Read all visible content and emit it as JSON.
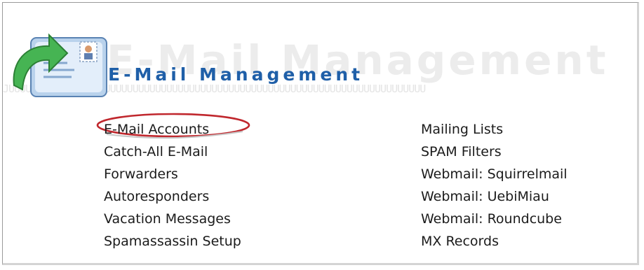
{
  "header": {
    "title": "E-Mail Management",
    "watermark": "E-Mail Management",
    "rail_pattern": "JUUUUUUUUUUUUUUUUUUUUUUUUUUUUUUUUUUUUUUUUUUUUUUUUUUUUUUUUUUUUUUUUUUUUUUUUUU"
  },
  "links": {
    "left": [
      "E-Mail Accounts",
      "Catch-All E-Mail",
      "Forwarders",
      "Autoresponders",
      "Vacation Messages",
      "Spamassassin Setup"
    ],
    "right": [
      "Mailing Lists",
      "SPAM Filters",
      "Webmail: Squirrelmail",
      "Webmail: UebiMiau",
      "Webmail: Roundcube",
      "MX Records"
    ]
  },
  "colors": {
    "title": "#1f5fa8",
    "highlight_ring": "#c0272d",
    "arrow": "#3aa64a",
    "envelope": "#bcd4ec"
  },
  "icons": [
    "email-management-logo-icon",
    "green-arrow-icon",
    "envelope-icon",
    "stamp-icon"
  ]
}
